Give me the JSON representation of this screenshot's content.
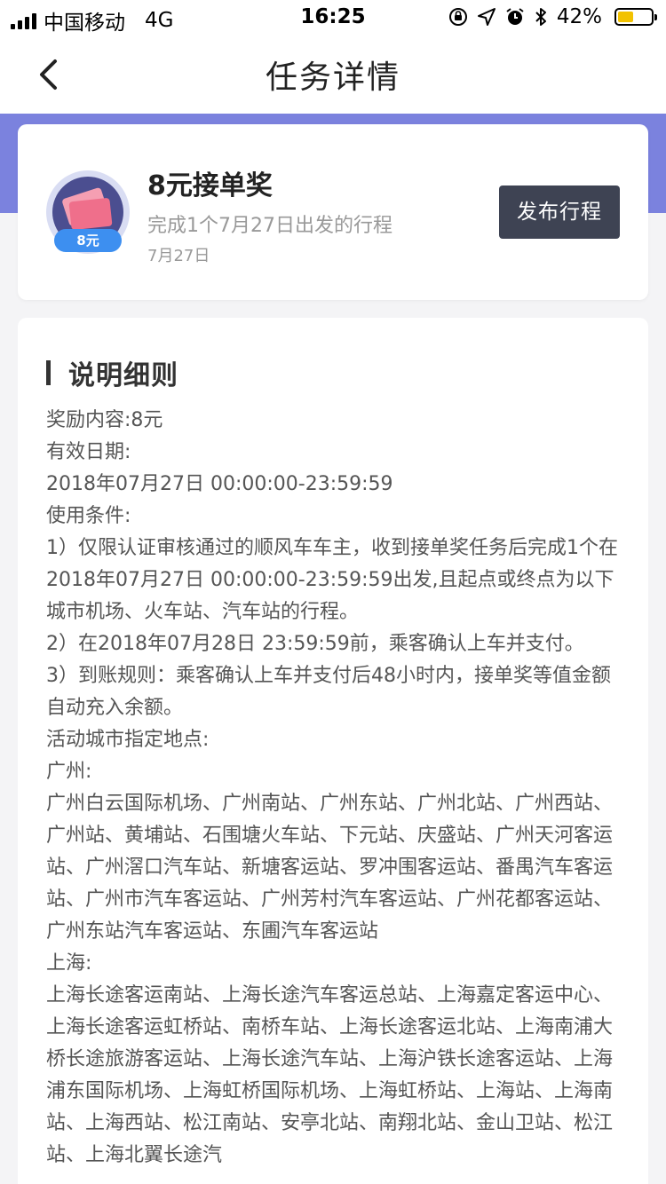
{
  "status_bar": {
    "carrier": "中国移动",
    "network": "4G",
    "time": "16:25",
    "battery_percent": "42%",
    "battery_level": 0.42
  },
  "nav": {
    "title": "任务详情"
  },
  "reward_card": {
    "badge": "8元",
    "title": "8元接单奖",
    "description": "完成1个7月27日出发的行程",
    "date": "7月27日",
    "publish_button": "发布行程"
  },
  "details": {
    "section_title": "说明细则",
    "lines": [
      "奖励内容:8元",
      "有效日期:",
      "2018年07月27日 00:00:00-23:59:59",
      "使用条件:",
      "1）仅限认证审核通过的顺风车车主，收到接单奖任务后完成1个在2018年07月27日 00:00:00-23:59:59出发,且起点或终点为以下城市机场、火车站、汽车站的行程。",
      "2）在2018年07月28日 23:59:59前，乘客确认上车并支付。",
      "3）到账规则：乘客确认上车并支付后48小时内，接单奖等值金额自动充入余额。",
      "活动城市指定地点:",
      "广州:",
      "广州白云国际机场、广州南站、广州东站、广州北站、广州西站、广州站、黄埔站、石围塘火车站、下元站、庆盛站、广州天河客运站、广州滘口汽车站、新塘客运站、罗冲围客运站、番禺汽车客运站、广州市汽车客运站、广州芳村汽车客运站、广州花都客运站、广州东站汽车客运站、东圃汽车客运站",
      "上海:",
      "上海长途客运南站、上海长途汽车客运总站、上海嘉定客运中心、上海长途客运虹桥站、南桥车站、上海长途客运北站、上海南浦大桥长途旅游客运站、上海长途汽车站、上海沪铁长途客运站、上海浦东国际机场、上海虹桥国际机场、上海虹桥站、上海站、上海南站、上海西站、松江南站、安亭北站、南翔北站、金山卫站、松江站、上海北翼长途汽"
    ]
  }
}
